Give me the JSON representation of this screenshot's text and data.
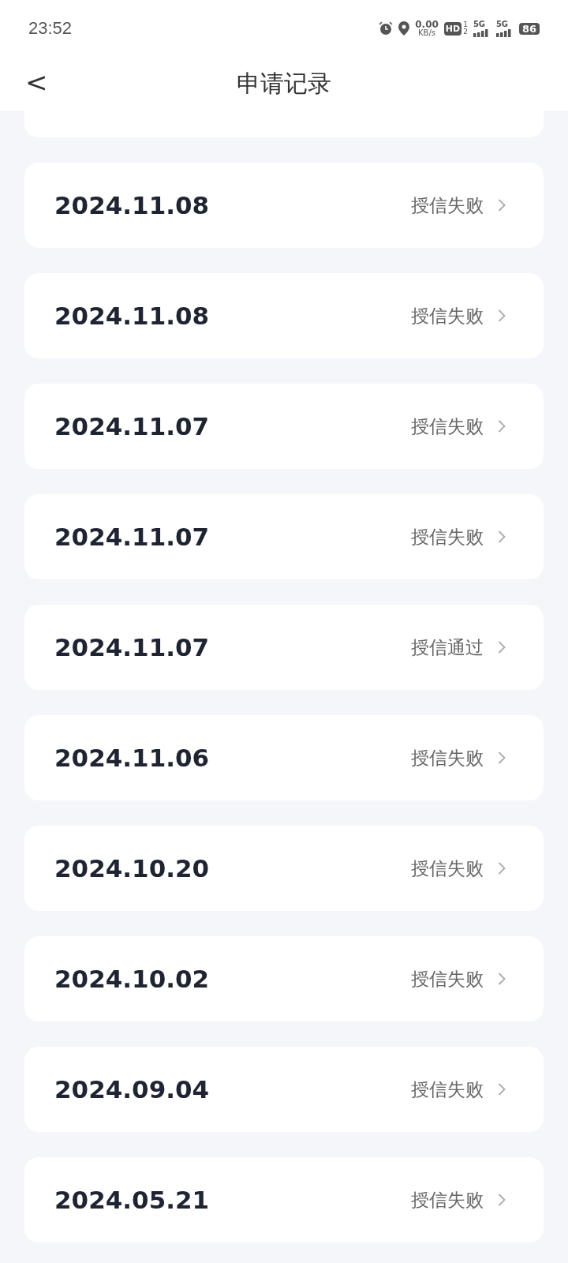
{
  "status_bar": {
    "time": "23:52",
    "speed_value": "0.00",
    "speed_unit": "KB/s",
    "hd": "HD",
    "hd_sims": [
      "1",
      "2"
    ],
    "signals": [
      {
        "label": "5G"
      },
      {
        "label": "5G"
      }
    ],
    "battery": "86"
  },
  "header": {
    "back": "<",
    "title": "申请记录"
  },
  "records": [
    {
      "date": "2024.11.08",
      "status": "授信失败"
    },
    {
      "date": "2024.11.08",
      "status": "授信失败"
    },
    {
      "date": "2024.11.07",
      "status": "授信失败"
    },
    {
      "date": "2024.11.07",
      "status": "授信失败"
    },
    {
      "date": "2024.11.07",
      "status": "授信通过"
    },
    {
      "date": "2024.11.06",
      "status": "授信失败"
    },
    {
      "date": "2024.10.20",
      "status": "授信失败"
    },
    {
      "date": "2024.10.02",
      "status": "授信失败"
    },
    {
      "date": "2024.09.04",
      "status": "授信失败"
    },
    {
      "date": "2024.05.21",
      "status": "授信失败"
    }
  ]
}
